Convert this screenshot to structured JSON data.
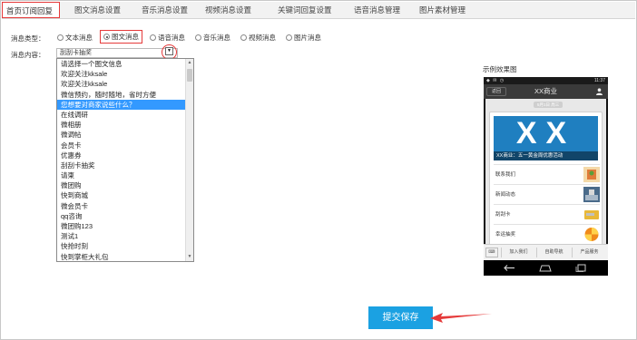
{
  "tabs": [
    {
      "label": "首页订阅回复"
    },
    {
      "label": "图文消息设置"
    },
    {
      "label": "音乐消息设置"
    },
    {
      "label": "视频消息设置"
    },
    {
      "label": "关键词回复设置"
    },
    {
      "label": "语音消息管理"
    },
    {
      "label": "图片素材管理"
    }
  ],
  "form": {
    "type_label": "消息类型：",
    "content_label": "消息内容：",
    "types": [
      {
        "label": "文本消息",
        "selected": false
      },
      {
        "label": "图文消息",
        "selected": true
      },
      {
        "label": "语音消息",
        "selected": false
      },
      {
        "label": "音乐消息",
        "selected": false
      },
      {
        "label": "视频消息",
        "selected": false
      },
      {
        "label": "图片消息",
        "selected": false
      }
    ],
    "select_value": "刮刮卡抽奖",
    "options": [
      "请选择一个图文信息",
      "欢迎关注kksale",
      "欢迎关注kksale",
      "微信预约，随时随地，省时方便",
      "您想要对商家说些什么？",
      "在线调研",
      "微相册",
      "微调帖",
      "会员卡",
      "优惠券",
      "刮刮卡抽奖",
      "请柬",
      "微团购",
      "快到商城",
      "微会员卡",
      "qq咨询",
      "微团购123",
      "测试1",
      "快抢时刻",
      "快到掌柜大礼包"
    ],
    "highlighted_index": 4
  },
  "preview": {
    "label": "示例效果图",
    "status_time": "11:37",
    "back_label": "返回",
    "title": "XX商业",
    "date_pill": "5月1日 周三",
    "cover_text": "XX",
    "cover_caption": "XX商业：五一黄金周优惠活动",
    "items": [
      {
        "label": "联系我们",
        "color": "#e07b39"
      },
      {
        "label": "新闻动态",
        "color": "#4a6b8a"
      },
      {
        "label": "刮刮卡",
        "color": "#e8b838"
      },
      {
        "label": "幸运抽奖",
        "color": "#f08a1a"
      }
    ],
    "menu": [
      "加入我们",
      "自助导航",
      "产品服务"
    ]
  },
  "submit_label": "提交保存",
  "colors": {
    "accent_red": "#e53a3a",
    "submit_blue": "#1ba1e2",
    "highlight_blue": "#3399ff",
    "cover_blue": "#1f7fc0"
  }
}
